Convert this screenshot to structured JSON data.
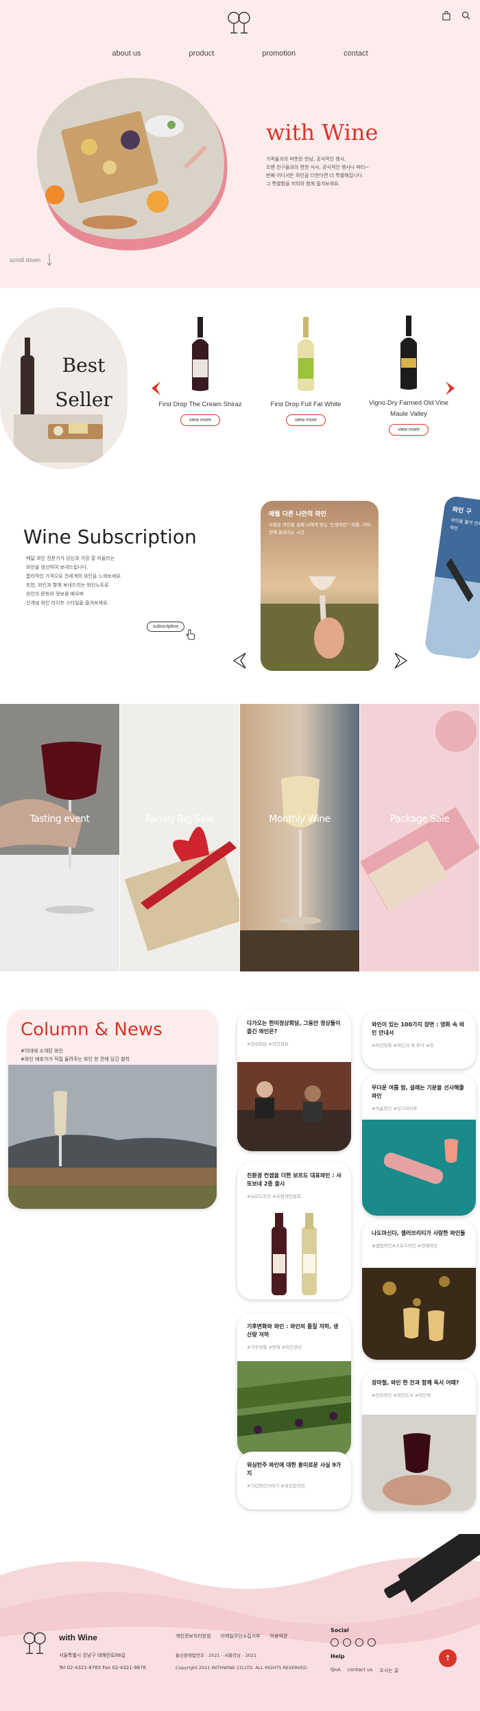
{
  "header": {
    "nav": [
      "about us",
      "product",
      "promotion",
      "contact"
    ],
    "cart_icon": "shopping-bag-icon",
    "search_icon": "search-icon"
  },
  "hero": {
    "title": "with Wine",
    "lines": [
      "가족들과의 따뜻한 만남, 공식적인 행사,",
      "오랜 친구들과의 편한 식사, 공식적인 행사나 파티~",
      "번째 어디서든 와인을 더한다면 더 특별해집니다.",
      "그 특별함을 저희와 함께 즐겨보세요."
    ],
    "scroll": "scroll down"
  },
  "best_seller": {
    "title_line1": "Best",
    "title_line2": "Seller",
    "products": [
      {
        "name": "First Drop The Cream Shiraz",
        "button": "view more"
      },
      {
        "name": "First Drop Full Fat White",
        "button": "view more"
      },
      {
        "name": "Vigno Dry Farmed Old Vine Maule Valley",
        "button": "view more"
      }
    ]
  },
  "subscription": {
    "title": "Wine Subscription",
    "lines": [
      "매달 와인 전문가가 당신과 가장 잘 어울리는",
      "와인을 엄선하여 보내드립니다.",
      "합리적인 가격으로 전세계의 와인을 느껴보세요.",
      "또한, 와인과 함께 보내드리는 와인노트로",
      "와인의 문화와 정보를 배우며",
      "신개념 와인 라이프 스타일을 즐겨보세요."
    ],
    "button": "subscription",
    "card1": {
      "title": "매월 다른 나만의 와인",
      "text": "수많은 와인을 실패 나에게 맞는 '인생와인'! 매월, 커피잔에 골라지는 시간"
    },
    "card2": {
      "title": "와인 구",
      "text": "와인을 즐겨 언제든지 와인"
    }
  },
  "events": [
    {
      "label": "Tasting event"
    },
    {
      "label": "Family Big Sale"
    },
    {
      "label": "Monthly Wine"
    },
    {
      "label": "Package Sale"
    }
  ],
  "news": {
    "title": "Column & News",
    "subs": [
      "#이대에 소개된 와인",
      "#와인 애호가가 직접 들려주는 와인 한 잔에 담긴 철학"
    ],
    "cards": [
      {
        "title": "다가오는 한미정상회담, 그동안 정상들이 즐긴 와인은?",
        "tags": "#정상회담   #와인정보"
      },
      {
        "title": "와인이 있는 100가지 장면 : 영화 속 와인 안내서",
        "tags": "#와인영화   #와인과 계 추어   #와"
      },
      {
        "title": "무더운 여름 밤, 설레는 기분을 선사해줄 와인",
        "tags": "#여름와인   #샹그리아추"
      },
      {
        "title": "친환경 컨셉을 더한 보르도 대표와인 : 샤또보네 2종 출시",
        "tags": "#보르도와인   #유럽와인협회"
      },
      {
        "title": "나도마신다, 셀러브리티가 사랑한 와인들",
        "tags": "#셀럽와인#스포츠와인   #연예와인"
      },
      {
        "title": "기후변화와 와인 : 와인의 품질 저하, 생산량 저하",
        "tags": "#기후변화   #변해   #와인생산"
      },
      {
        "title": "장마철, 와인 한 잔과 함께 독서 어때?",
        "tags": "#장마와인   #와인도서   #와인책"
      },
      {
        "title": "워싱턴주 와인에 대한 흥미로운 사실 9가지",
        "tags": "#기년와인이야기   #워싱턴와인"
      }
    ]
  },
  "footer": {
    "brand": "with Wine",
    "address": "서울특별시 강남구 테헤란로88길",
    "contact": "Tel 02-4321-8765    Fax 02-4321-9876",
    "links": [
      "개인정보처리방침",
      "이메일무단수집거부",
      "이용약관"
    ],
    "registration": "통신판매업번호 : 2021 - 서울강남 - 2021",
    "copyright": "Copyright 2021 WITHWINE CO.LTD. ALL RIGHTS RESERVED.",
    "social_title": "Social",
    "help_title": "Help",
    "help_links": [
      "QnA",
      "contact us",
      "오시는 길"
    ],
    "top_button": "↑"
  },
  "colors": {
    "accent": "#d8352a",
    "pink": "#fdecec"
  }
}
